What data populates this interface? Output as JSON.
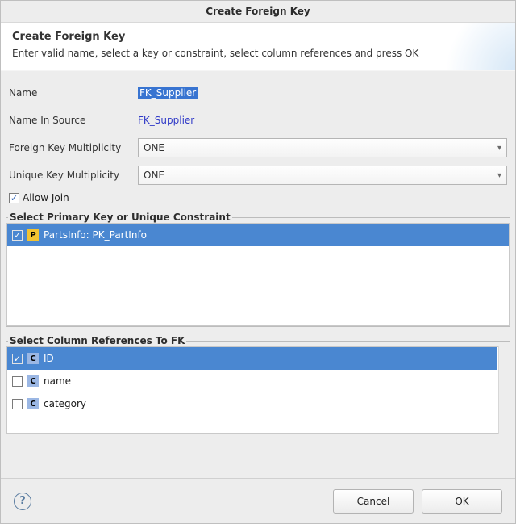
{
  "window": {
    "title": "Create Foreign Key"
  },
  "header": {
    "title": "Create Foreign Key",
    "description": "Enter valid name, select a key or constraint, select column references and press OK"
  },
  "form": {
    "name_label": "Name",
    "name_value": "FK_Supplier",
    "name_in_source_label": "Name In Source",
    "name_in_source_value": "FK_Supplier",
    "fk_mult_label": "Foreign Key Multiplicity",
    "fk_mult_value": "ONE",
    "uk_mult_label": "Unique Key Multiplicity",
    "uk_mult_value": "ONE",
    "allow_join_label": "Allow Join",
    "allow_join_checked": true
  },
  "pk_group": {
    "legend": "Select Primary Key or Unique Constraint",
    "items": [
      {
        "checked": true,
        "selected": true,
        "icon": "P",
        "label": "PartsInfo: PK_PartInfo"
      }
    ]
  },
  "col_group": {
    "legend": "Select Column References To FK",
    "items": [
      {
        "checked": true,
        "selected": true,
        "icon": "C",
        "label": "ID"
      },
      {
        "checked": false,
        "selected": false,
        "icon": "C",
        "label": "name"
      },
      {
        "checked": false,
        "selected": false,
        "icon": "C",
        "label": "category"
      }
    ]
  },
  "buttons": {
    "cancel": "Cancel",
    "ok": "OK"
  }
}
